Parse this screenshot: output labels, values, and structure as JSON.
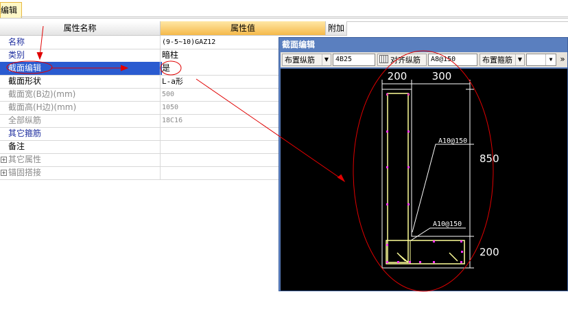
{
  "tab": {
    "label": "编辑"
  },
  "grid": {
    "headers": {
      "name": "属性名称",
      "value": "属性值",
      "extra": "附加"
    },
    "rows": [
      {
        "name": "名称",
        "value": "(9-5~10)GAZ12"
      },
      {
        "name": "类别",
        "value": "暗柱"
      },
      {
        "name": "截面编辑",
        "value": "是"
      },
      {
        "name": "截面形状",
        "value": "L-a形"
      },
      {
        "name": "截面宽(B边)(mm)",
        "value": "500"
      },
      {
        "name": "截面高(H边)(mm)",
        "value": "1050"
      },
      {
        "name": "全部纵筋",
        "value": "18C16"
      },
      {
        "name": "其它箍筋",
        "value": ""
      },
      {
        "name": "备注",
        "value": ""
      },
      {
        "name": "其它属性",
        "value": ""
      },
      {
        "name": "锚固搭接",
        "value": ""
      }
    ]
  },
  "editor": {
    "title": "截面编辑",
    "toolbar": {
      "place_long_bar": "布置纵筋",
      "long_bar_value": "4B25",
      "align_long_bar": "对齐纵筋",
      "stirrup_value": "A8@150",
      "place_stirrup": "布置箍筋",
      "more": "»"
    },
    "drawing": {
      "dim_top_left": "200",
      "dim_top_right": "300",
      "dim_right": "850",
      "dim_right_bottom": "200",
      "label_stirrup_1": "A10@150",
      "label_stirrup_2": "A10@150"
    }
  },
  "colors": {
    "selection": "#2a5bd0",
    "header_value": "#f5b94a",
    "annotation_red": "#e00000",
    "bar_magenta": "#ff33ff",
    "outline_yellow": "#ffff99"
  }
}
